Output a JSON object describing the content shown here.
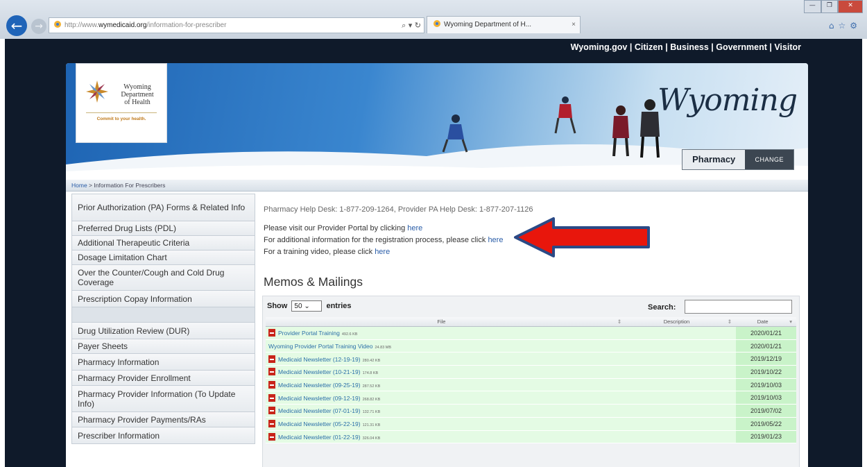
{
  "browser": {
    "url_prefix": "http://www.",
    "url_domain": "wymedicaid.org",
    "url_path": "/information-for-prescriber",
    "addr_controls": "⌕ ▾ ↻",
    "tab_title": "Wyoming Department of H...",
    "tab_close": "×",
    "back_icon": "←",
    "fwd_icon": "→",
    "win_min": "—",
    "win_max": "❐",
    "win_close": "✕",
    "right_icons": "⌂☆⚙"
  },
  "top_nav": "Wyoming.gov | Citizen | Business | Government | Visitor",
  "logo": {
    "line1": "Wyoming",
    "line2": "Department",
    "line3": "of Health",
    "tagline": "Commit to your health."
  },
  "banner": {
    "script_title": "Wyoming",
    "badge_left": "Pharmacy",
    "badge_right": "CHANGE"
  },
  "breadcrumb": {
    "home": "Home",
    "rest": " > Information For Prescribers"
  },
  "sidebar": {
    "items": [
      {
        "label": "Prior Authorization (PA) Forms & Related Info",
        "h": 40
      },
      {
        "label": "Preferred Drug Lists (PDL)",
        "h": 21
      },
      {
        "label": "Additional Therapeutic Criteria",
        "h": 21
      },
      {
        "label": "Dosage Limitation Chart",
        "h": 21
      },
      {
        "label": "Over the Counter/Cough and Cold Drug Coverage",
        "h": 37
      },
      {
        "label": "Prescription Copay Information",
        "h": 24
      }
    ],
    "items2": [
      {
        "label": "Drug Utilization Review (DUR)",
        "h": 24
      },
      {
        "label": "Payer Sheets",
        "h": 21
      },
      {
        "label": "Pharmacy Information",
        "h": 24
      },
      {
        "label": "Pharmacy Provider Enrollment",
        "h": 22
      },
      {
        "label": "Pharmacy Provider Information (To Update Info)",
        "h": 38
      },
      {
        "label": "Pharmacy Provider Payments/RAs",
        "h": 22
      },
      {
        "label": "Prescriber Information",
        "h": 24
      }
    ]
  },
  "main": {
    "helpdesk": "Pharmacy Help Desk: 1-877-209-1264, Provider PA Help Desk: 1-877-207-1126",
    "line1_text": "Please visit our Provider Portal by clicking ",
    "line1_link": "here",
    "line2_text": "For additional information for the registration process, please click ",
    "line2_link": "here",
    "line3_text": "For a training video, please click ",
    "line3_link": "here",
    "memos_heading": "Memos & Mailings"
  },
  "table": {
    "show_label": "Show",
    "entries_value": "50",
    "entries_label": "entries",
    "search_label": "Search:",
    "search_value": "",
    "columns": [
      "File",
      "Description",
      "Date"
    ],
    "rows": [
      {
        "file": "Provider Portal Training",
        "size": "492.6 KB",
        "date": "2020/01/21",
        "pdf": true
      },
      {
        "file": "Wyoming Provider Portal Training Video",
        "size": "24.83 MB",
        "date": "2020/01/21",
        "pdf": false
      },
      {
        "file": "Medicaid Newsletter (12-19-19)",
        "size": "280.42 KB",
        "date": "2019/12/19",
        "pdf": true
      },
      {
        "file": "Medicaid Newsletter (10-21-19)",
        "size": "174.8 KB",
        "date": "2019/10/22",
        "pdf": true
      },
      {
        "file": "Medicaid Newsletter (09-25-19)",
        "size": "287.52 KB",
        "date": "2019/10/03",
        "pdf": true
      },
      {
        "file": "Medicaid Newsletter (09-12-19)",
        "size": "268.82 KB",
        "date": "2019/10/03",
        "pdf": true
      },
      {
        "file": "Medicaid Newsletter (07-01-19)",
        "size": "132.71 KB",
        "date": "2019/07/02",
        "pdf": true
      },
      {
        "file": "Medicaid Newsletter (05-22-19)",
        "size": "121.31 KB",
        "date": "2019/05/22",
        "pdf": true
      },
      {
        "file": "Medicaid Newsletter (01-22-19)",
        "size": "326.04 KB",
        "date": "2019/01/23",
        "pdf": true
      }
    ]
  },
  "colors": {
    "page_bg": "#0f1a2a",
    "link": "#2a5da8",
    "row_green": "#e4fbe4",
    "date_green": "#c9f3c9",
    "arrow_red": "#e8160c",
    "arrow_outline": "#2b4a86"
  }
}
